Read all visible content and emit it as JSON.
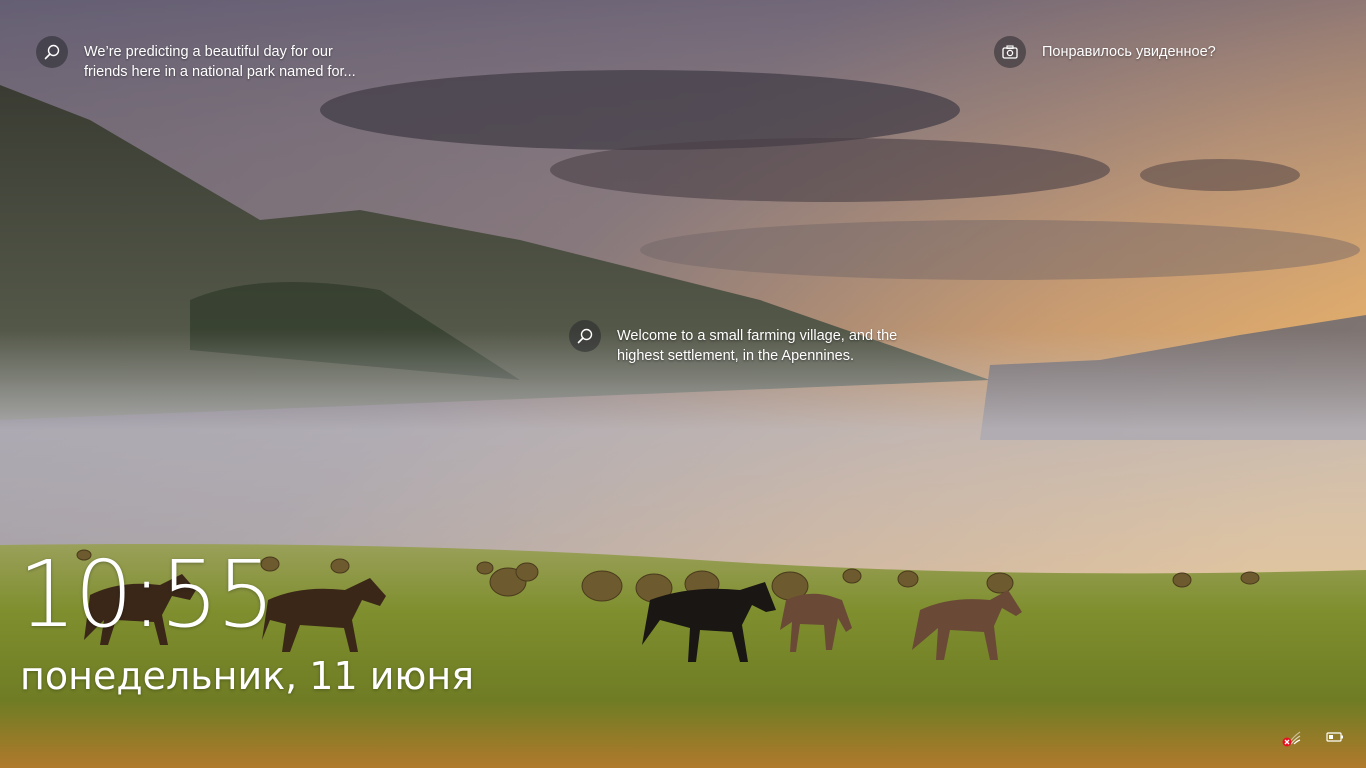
{
  "hotspots": [
    {
      "icon": "search-icon",
      "text": "We’re predicting a beautiful day for our friends here in a national park named for..."
    },
    {
      "icon": "search-icon",
      "text": "Welcome to a small farming village, and the highest settlement, in the Apennines."
    }
  ],
  "feedback": {
    "icon": "camera-icon",
    "text": "Понравилось увиденное?"
  },
  "clock": {
    "time": "10:55",
    "date": "понедельник, 11 июня"
  },
  "status": {
    "network_icon": "network-disconnected-icon",
    "battery_icon": "battery-icon"
  },
  "colors": {
    "sky_top": "#6f6b80",
    "sunset": "#e9a75a",
    "meadow": "#7d8c2e",
    "text": "#ffffff"
  }
}
